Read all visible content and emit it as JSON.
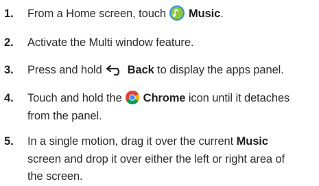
{
  "steps": [
    {
      "number": "1.",
      "text_before": "From a Home screen, touch",
      "icon": "music-icon",
      "bold": "Music",
      "text_after": "."
    },
    {
      "number": "2.",
      "text": "Activate the Multi window feature."
    },
    {
      "number": "3.",
      "text_before": "Press and hold",
      "icon": "back-icon",
      "bold": "Back",
      "text_after": "to display the apps panel."
    },
    {
      "number": "4.",
      "text_before": "Touch and hold the",
      "icon": "chrome-icon",
      "bold": "Chrome",
      "text_after": "icon until it detaches",
      "text_line2": "from the panel."
    },
    {
      "number": "5.",
      "text_before": "In a single motion, drag it over the current",
      "bold": "Music",
      "text_line2": "screen and drop it over either the left or right area of",
      "text_line3": "the screen."
    }
  ],
  "colors": {
    "music_green": "#7dc142",
    "music_blue": "#2a8fd6",
    "text": "#2b2b2b"
  }
}
